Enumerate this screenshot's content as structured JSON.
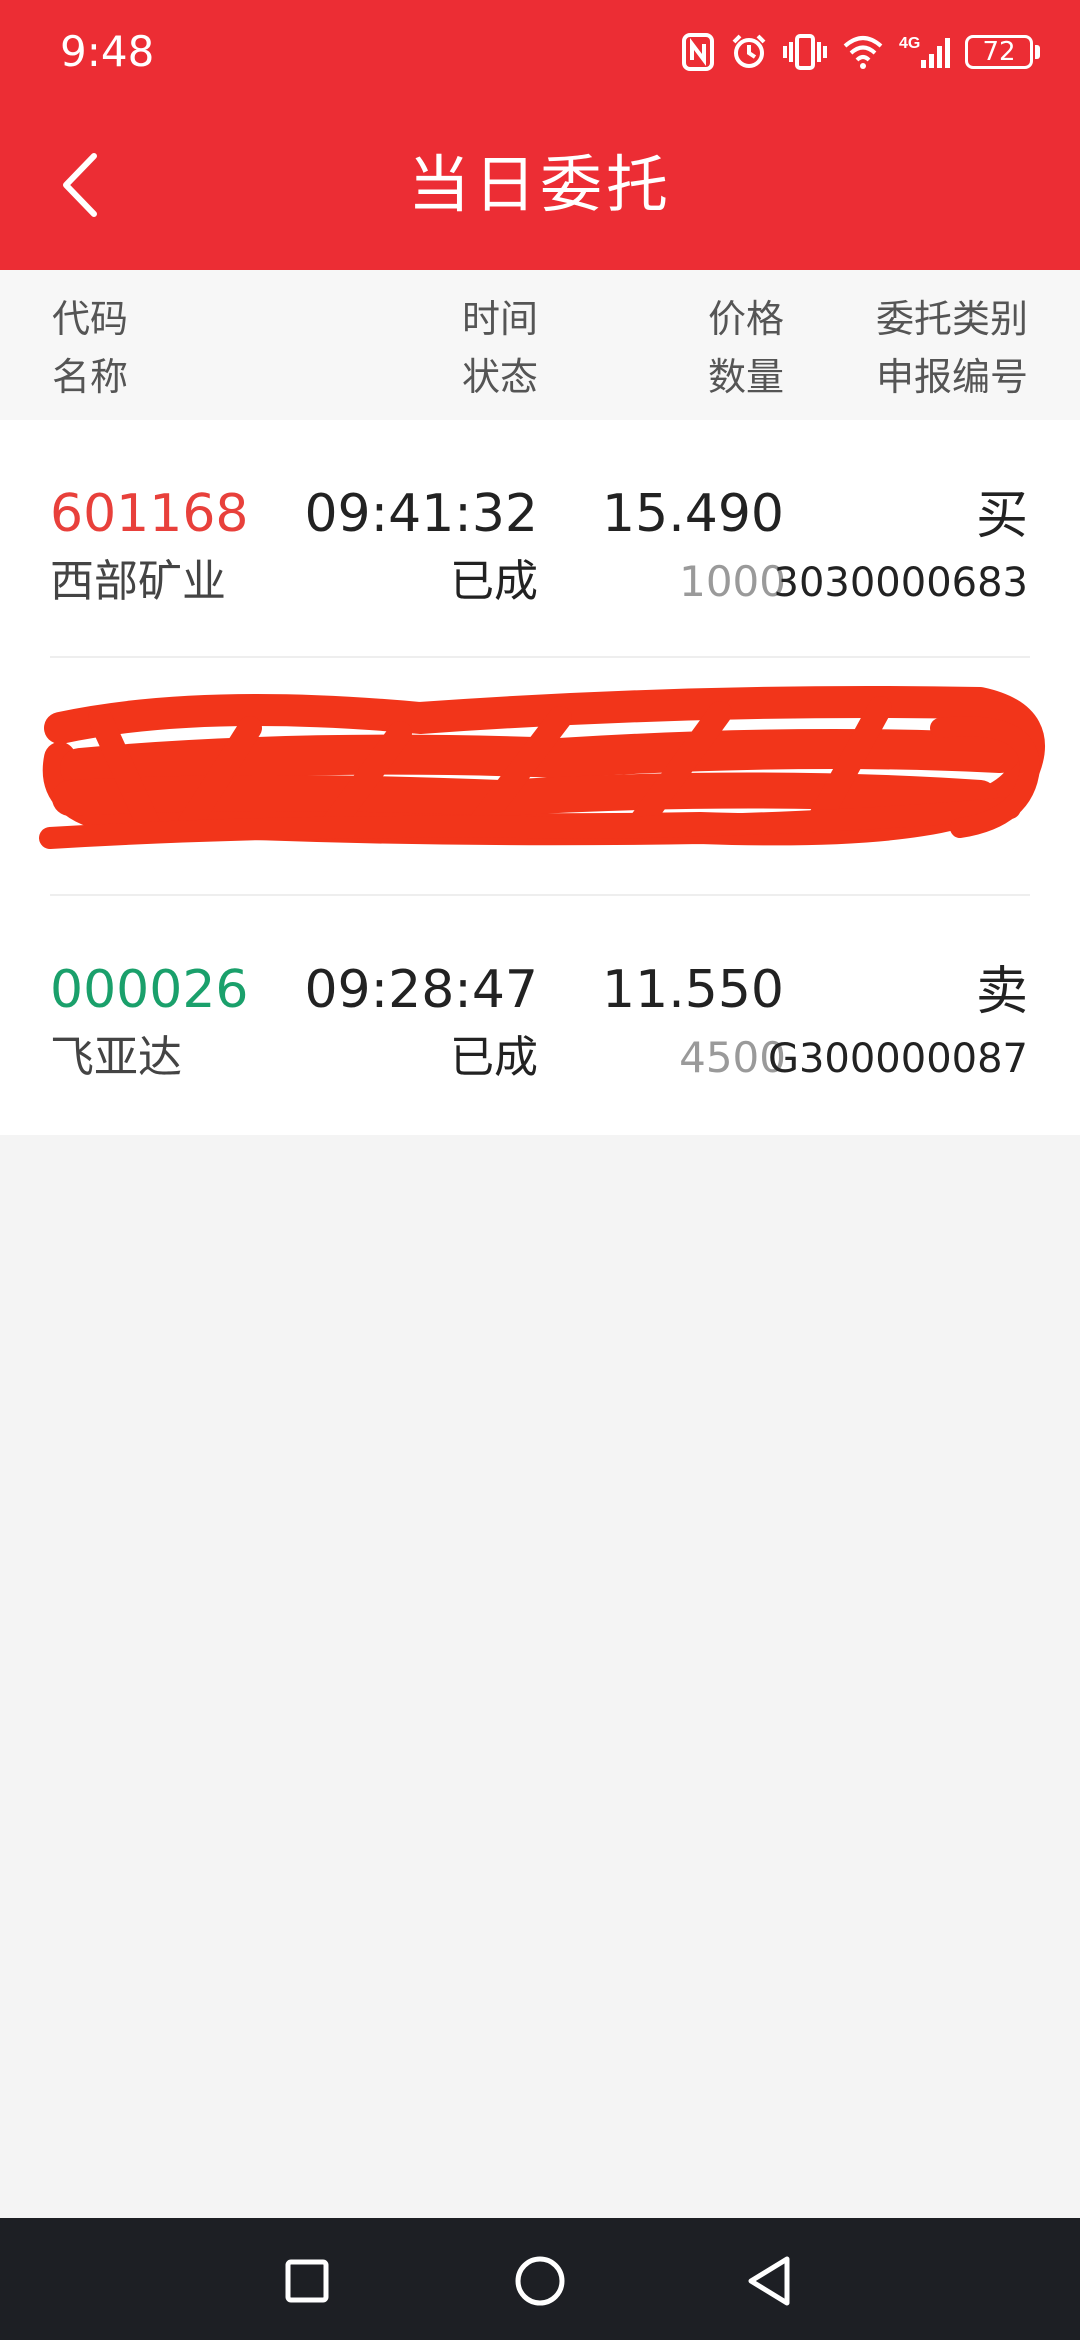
{
  "status_bar": {
    "time": "9:48",
    "battery": "72",
    "icons": [
      "nfc-icon",
      "alarm-icon",
      "vibrate-icon",
      "wifi-icon",
      "signal-4g-icon",
      "battery-icon"
    ]
  },
  "header": {
    "title": "当日委托",
    "back_icon": "chevron-left-icon",
    "background": "#ec2d34"
  },
  "columns": {
    "code": "代码",
    "name": "名称",
    "time": "时间",
    "status": "状态",
    "price": "价格",
    "quantity": "数量",
    "order_type": "委托类别",
    "order_no": "申报编号"
  },
  "orders": [
    {
      "code": "601168",
      "name": "西部矿业",
      "time": "09:41:32",
      "status": "已成",
      "price": "15.490",
      "quantity": "1000",
      "type": "买",
      "order_no": "3030000683",
      "code_color": "#e8403b"
    },
    {
      "code": "",
      "name": "",
      "time": "",
      "status": "",
      "price": "",
      "quantity": "",
      "type": "",
      "order_no": "",
      "redacted": true
    },
    {
      "code": "000026",
      "name": "飞亚达",
      "time": "09:28:47",
      "status": "已成",
      "price": "11.550",
      "quantity": "4500",
      "type": "卖",
      "order_no": "G300000087",
      "code_color": "#1aa06b"
    }
  ],
  "nav": {
    "recents_icon": "square-icon",
    "home_icon": "circle-icon",
    "back_icon": "triangle-back-icon"
  }
}
